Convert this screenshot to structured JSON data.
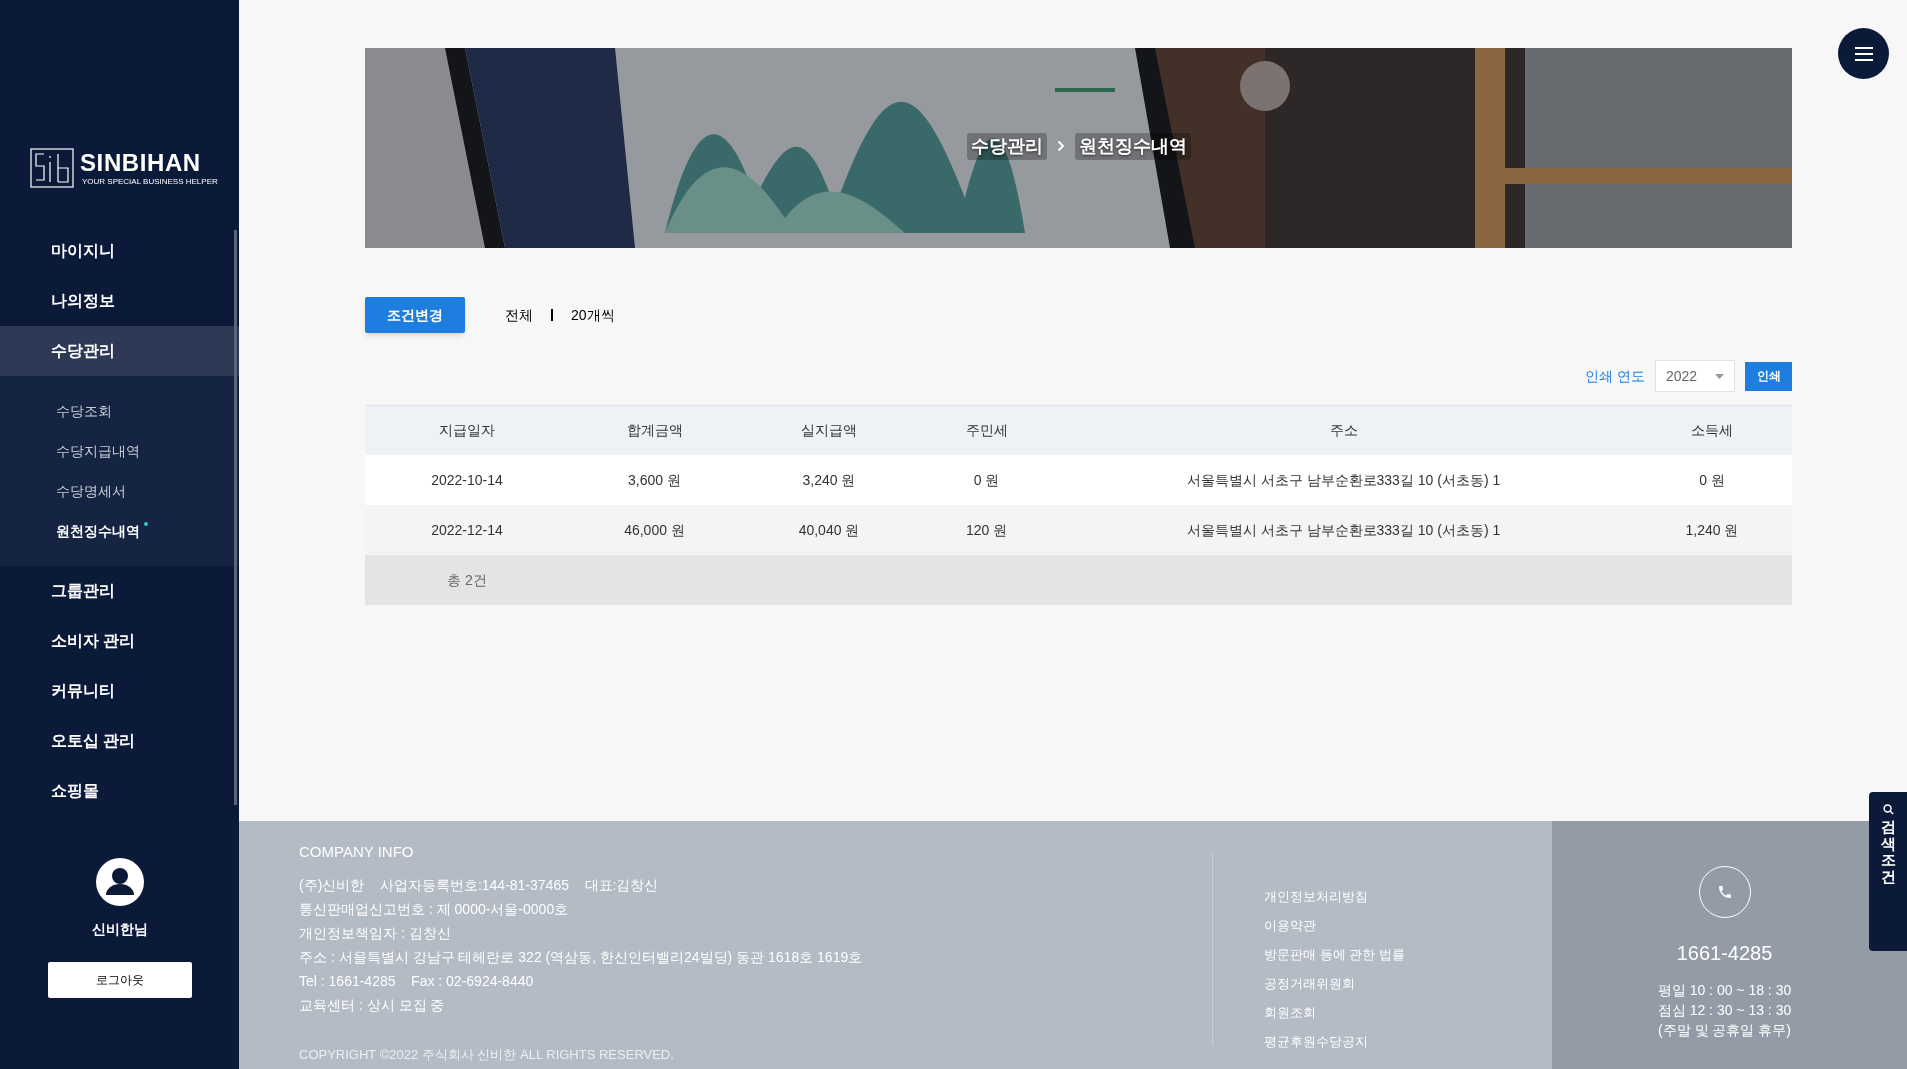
{
  "sidebar": {
    "logo": {
      "name": "SINBIHAN",
      "tagline": "YOUR SPECIAL BUSINESS HELPER"
    },
    "items": [
      {
        "label": "마이지니",
        "selected": false
      },
      {
        "label": "나의정보",
        "selected": false
      },
      {
        "label": "수당관리",
        "selected": true,
        "children": [
          {
            "label": "수당조회",
            "selected": false
          },
          {
            "label": "수당지급내역",
            "selected": false
          },
          {
            "label": "수당명세서",
            "selected": false
          },
          {
            "label": "원천징수내역",
            "selected": true
          }
        ]
      },
      {
        "label": "그룹관리",
        "selected": false
      },
      {
        "label": "소비자 관리",
        "selected": false
      },
      {
        "label": "커뮤니티",
        "selected": false
      },
      {
        "label": "오토십 관리",
        "selected": false
      },
      {
        "label": "쇼핑몰",
        "selected": false
      }
    ],
    "user": {
      "name": "신비한님"
    },
    "logout_button": "로그아웃"
  },
  "banner": {
    "breadcrumb": [
      "수당관리",
      "원천징수내역"
    ]
  },
  "toolbar": {
    "condition_button": "조건변경",
    "filters": [
      "전체",
      "20개씩"
    ]
  },
  "print": {
    "label": "인쇄 연도",
    "year": "2022",
    "button": "인쇄"
  },
  "table": {
    "columns": [
      "지급일자",
      "합계금액",
      "실지급액",
      "주민세",
      "주소",
      "소득세"
    ],
    "rows": [
      [
        "2022-10-14",
        "3,600 원",
        "3,240 원",
        "0 원",
        "서울특별시 서초구 남부순환로333길 10 (서초동) 1",
        "0 원"
      ],
      [
        "2022-12-14",
        "46,000 원",
        "40,040 원",
        "120 원",
        "서울특별시 서초구 남부순환로333길 10 (서초동) 1",
        "1,240 원"
      ]
    ],
    "total": "총 2건"
  },
  "footer": {
    "title": "COMPANY INFO",
    "lines": [
      "(주)신비한    사업자등록번호:144-81-37465    대표:김창신",
      "통신판매업신고번호 : 제 0000-서울-0000호",
      "개인정보책임자 : 김창신",
      "주소 : 서울특별시 강남구 테헤란로 322 (역삼동, 한신인터밸리24빌딩) 동관 1618호 1619호",
      "Tel : 1661-4285    Fax : 02-6924-8440",
      "교육센터 : 상시 모집 중"
    ],
    "copyright": "COPYRIGHT ©2022 주식회사 신비한 ALL RIGHTS RESERVED.",
    "links": [
      "개인정보처리방침",
      "이용약관",
      "방문판매 등에 관한 법률",
      "공정거래위원회",
      "회원조회",
      "평균후원수당공지"
    ],
    "phone": "1661-4285",
    "hours": [
      "평일 10 : 00 ~ 18 : 30",
      "점심 12 : 30 ~ 13 : 30",
      "(주말 및 공휴일 휴무)"
    ]
  },
  "side_tab": {
    "label": "검색조건"
  }
}
